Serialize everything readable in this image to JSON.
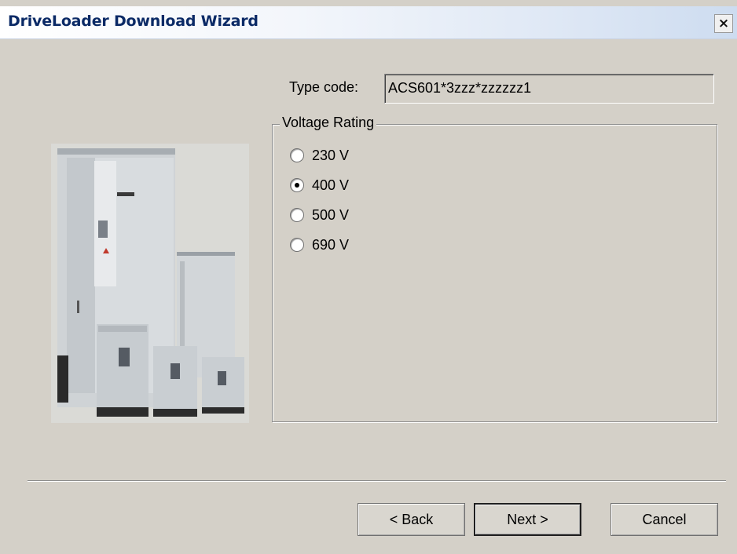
{
  "window": {
    "title": "DriveLoader Download Wizard",
    "close_glyph": "×"
  },
  "type_code": {
    "label": "Type code:",
    "value": "ACS601*3zzz*zzzzzz1"
  },
  "voltage_rating": {
    "legend": "Voltage Rating",
    "selected": "400 V",
    "options": [
      {
        "label": "230 V",
        "checked": false
      },
      {
        "label": "400 V",
        "checked": true
      },
      {
        "label": "500 V",
        "checked": false
      },
      {
        "label": "690 V",
        "checked": false
      }
    ]
  },
  "image": {
    "icon": "drive-cabinet-photo"
  },
  "buttons": {
    "back": "< Back",
    "next": "Next >",
    "cancel": "Cancel"
  }
}
